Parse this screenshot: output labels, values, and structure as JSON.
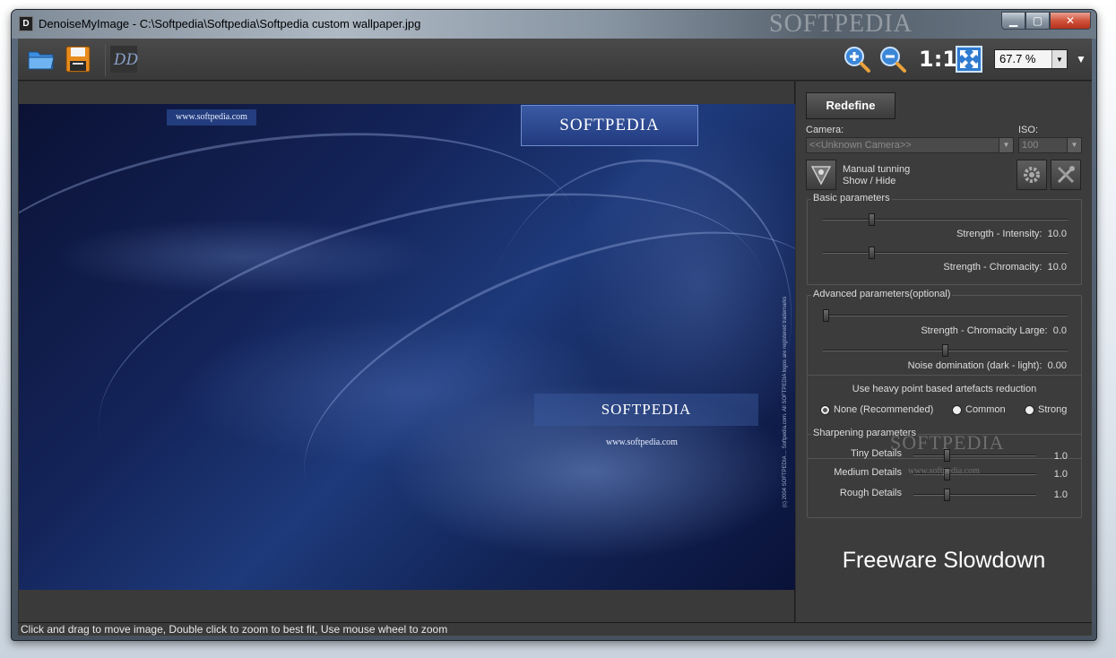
{
  "window": {
    "title": "DenoiseMyImage - C:\\Softpedia\\Softpedia\\Softpedia custom wallpaper.jpg",
    "app_icon_text": "D",
    "controls": {
      "minimize": "▁",
      "maximize": "▢",
      "close": "✕"
    }
  },
  "toolbar": {
    "icons": [
      "open-folder-icon",
      "save-icon",
      "logo-icon",
      "zoom-in-icon",
      "zoom-out-icon",
      "fit-icon"
    ],
    "one_to_one": "1:1",
    "zoom_value": "67.7 %",
    "menu_arrow": "▼"
  },
  "image": {
    "url_top": "www.softpedia.com",
    "logo_top": "SOFTPEDIA",
    "logo_mid": "SOFTPEDIA",
    "url_mid": "www.softpedia.com",
    "vertical_text": "(c) 2004 SOFTPEDIA ... Softpedia.com. All SOFTPEDIA logos are registered trademarks"
  },
  "panel": {
    "redefine_label": "Redefine",
    "camera_label": "Camera:",
    "camera_value": "<<Unknown Camera>>",
    "iso_label": "ISO:",
    "iso_value": "100",
    "manual_line1": "Manual tunning",
    "manual_line2": "Show / Hide",
    "basic": {
      "title": "Basic parameters",
      "intensity_label": "Strength - Intensity:",
      "intensity_value": "10.0",
      "intensity_level": 0.19,
      "chroma_label": "Strength - Chromacity:",
      "chroma_value": "10.0",
      "chroma_level": 0.19
    },
    "advanced": {
      "title": "Advanced parameters(optional)",
      "chroma_large_label": "Strength - Chromacity Large:",
      "chroma_large_value": "0.0",
      "chroma_large_level": 0.0,
      "noise_label": "Noise domination (dark - light):",
      "noise_value": "0.00",
      "noise_level": 0.5
    },
    "artefacts": {
      "title": "Use heavy point based artefacts reduction",
      "options": [
        "None (Recommended)",
        "Common",
        "Strong"
      ],
      "selected": "None (Recommended)"
    },
    "sharpening": {
      "title": "Sharpening parameters",
      "tiny_label": "Tiny Details",
      "tiny_value": "1.0",
      "medium_label": "Medium Details",
      "medium_value": "1.0",
      "rough_label": "Rough Details",
      "rough_value": "1.0"
    },
    "watermark": "SOFTPEDIA",
    "watermark_url": "www.softpedia.com",
    "freeware": "Freeware Slowdown"
  },
  "status": {
    "text": "Click and drag to move image, Double click to zoom to best fit, Use mouse wheel to zoom"
  },
  "desktop": {
    "title_watermark": "SOFTPEDIA"
  }
}
